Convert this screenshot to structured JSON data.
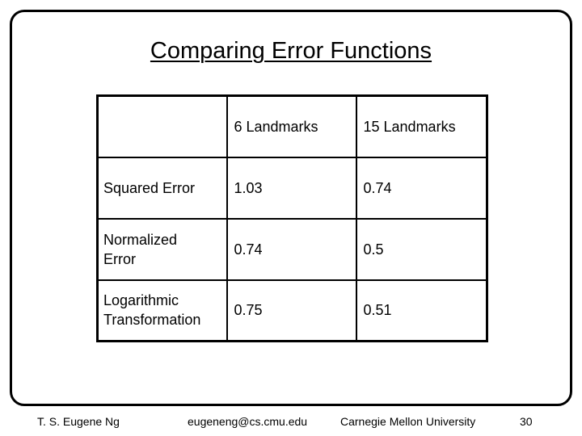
{
  "slide": {
    "title": "Comparing Error Functions"
  },
  "table": {
    "header": [
      "",
      "6 Landmarks",
      "15 Landmarks"
    ],
    "rows": [
      {
        "label": "Squared Error",
        "values": [
          "1.03",
          "0.74"
        ]
      },
      {
        "label": "Normalized\nError",
        "values": [
          "0.74",
          "0.5"
        ]
      },
      {
        "label": "Logarithmic\nTransformation",
        "values": [
          "0.75",
          "0.51"
        ]
      }
    ]
  },
  "footer": {
    "author": "T. S. Eugene Ng",
    "email": "eugeneng@cs.cmu.edu",
    "institution": "Carnegie Mellon University",
    "page_number": "30"
  }
}
